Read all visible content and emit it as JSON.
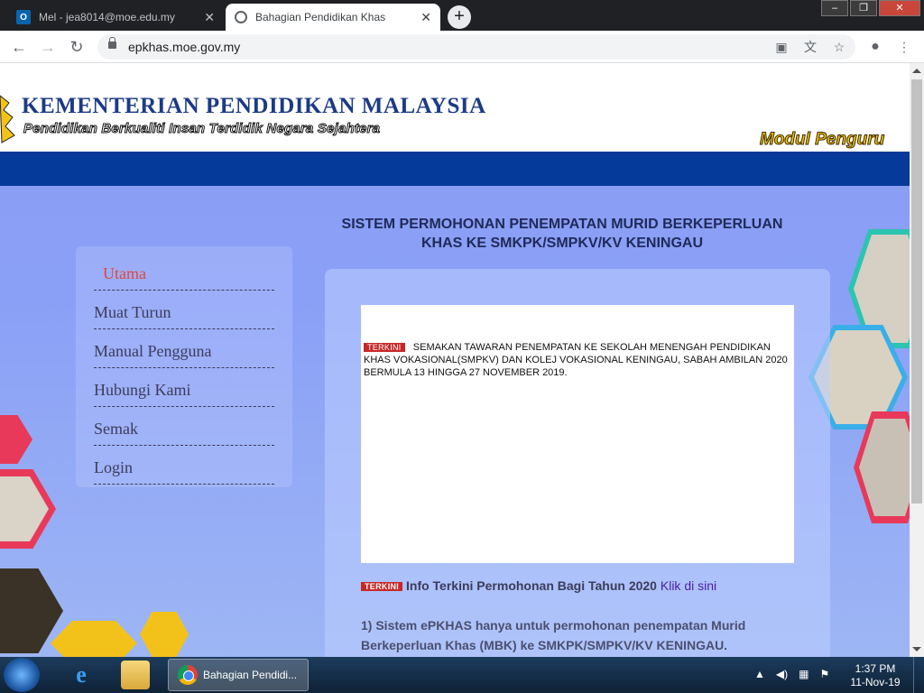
{
  "browser": {
    "tabs": [
      {
        "title": "Mel - jea8014@moe.edu.my",
        "icon": "outlook-icon",
        "active": false
      },
      {
        "title": "Bahagian Pendidikan Khas",
        "icon": "globe-icon",
        "active": true
      }
    ],
    "close_glyph": "✕",
    "new_tab_glyph": "+",
    "url": "epkhas.moe.gov.my",
    "nav": {
      "back": "←",
      "forward": "→",
      "reload": "↻"
    }
  },
  "header": {
    "title": "KEMENTERIAN PENDIDIKAN MALAYSIA",
    "tagline": "Pendidikan Berkualiti Insan Terdidik Negara Sejahtera",
    "module_label": "Modul Penguru"
  },
  "page": {
    "title_line1": "SISTEM PERMOHONAN PENEMPATAN MURID BERKEPERLUAN",
    "title_line2": "KHAS KE SMKPK/SMPKV/KV KENINGAU"
  },
  "menu": {
    "items": [
      "Utama",
      "Muat Turun",
      "Manual Pengguna",
      "Hubungi Kami",
      "Semak",
      "Login"
    ]
  },
  "news": {
    "badge": "TERKINI",
    "text": "SEMAKAN TAWARAN PENEMPATAN KE SEKOLAH MENENGAH PENDIDIKAN KHAS VOKASIONAL(SMPKV) DAN KOLEJ VOKASIONAL KENINGAU, SABAH AMBILAN 2020 BERMULA 13 HINGGA 27 NOVEMBER 2019."
  },
  "info": {
    "badge": "TERKINI",
    "text": "Info Terkini Permohonan Bagi Tahun 2020",
    "link": "Klik di sini"
  },
  "note": {
    "line1": "1) Sistem ePKHAS hanya untuk permohonan penempatan Murid",
    "line2": "Berkeperluan Khas (MBK) ke SMKPK/SMPKV/KV KENINGAU."
  },
  "taskbar": {
    "chrome_label": "Bahagian Pendidi...",
    "time": "1:37 PM",
    "date": "11-Nov-19"
  },
  "colors": {
    "header_blue": "#063a9a",
    "title_navy": "#1b3a86",
    "badge_red": "#c62828",
    "menu_active": "#e0483a",
    "link_purple": "#4b1fa6"
  }
}
